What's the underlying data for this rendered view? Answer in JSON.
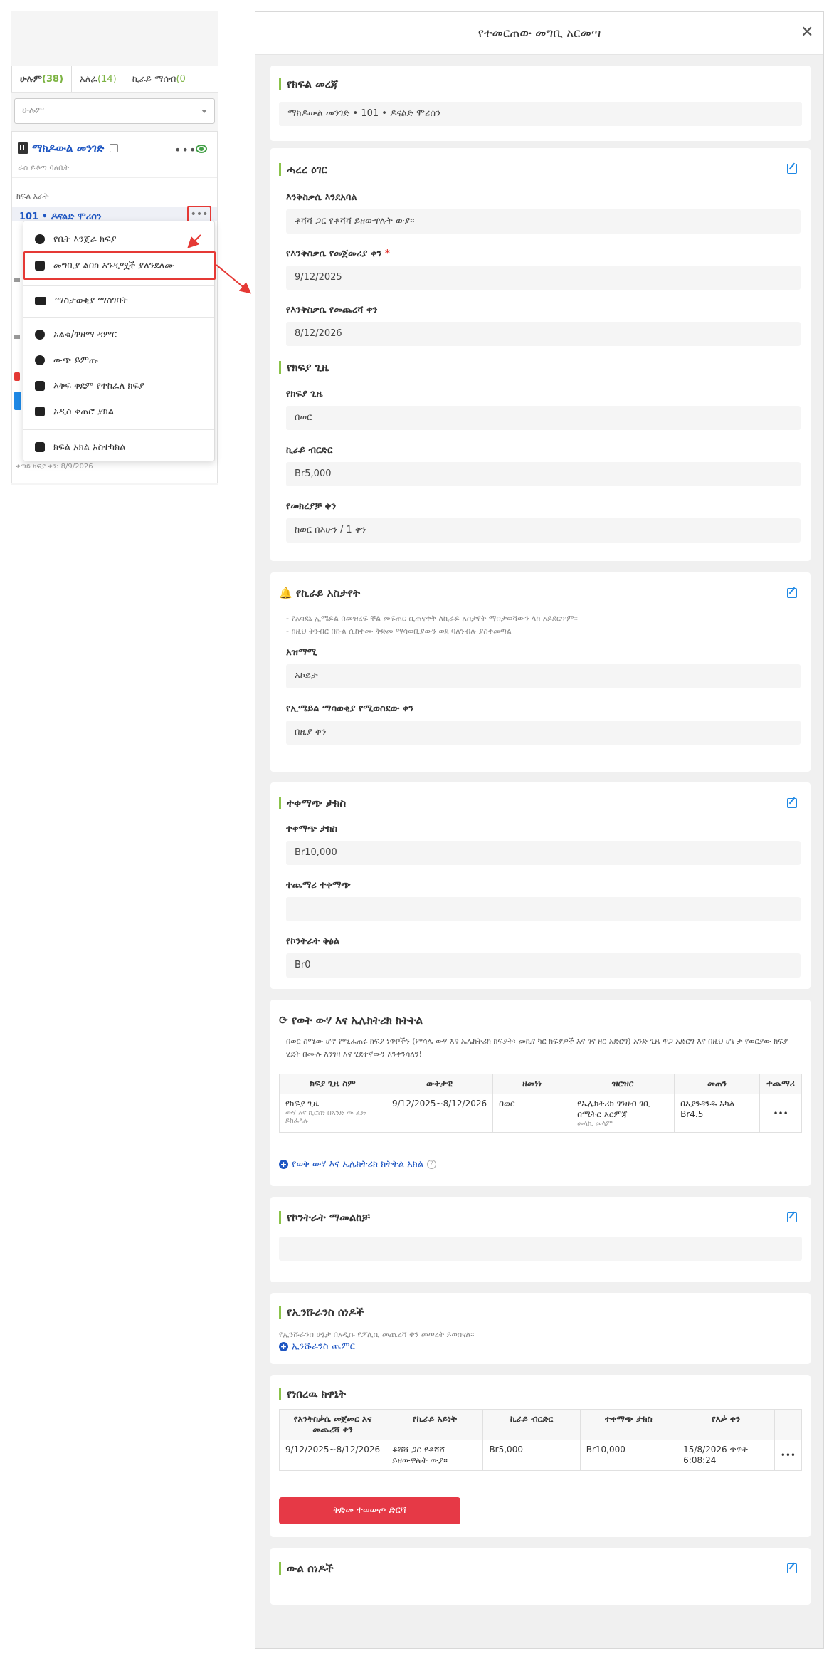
{
  "left": {
    "tabs": [
      {
        "label": "ሁሉም",
        "count": "(38)"
      },
      {
        "label": "አለፈ",
        "count": "(14)"
      },
      {
        "label": "ኪራይ ማሰብ",
        "count": "(0"
      }
    ],
    "filter_value": "ሁሉም",
    "property_name": "ማክዶውል መንገድ",
    "property_sub": "ራስ ይቆጣ ባለቤት",
    "unit_header": "ክፍል አራት",
    "unit_link": "101 • ዶናልድ ሞሪሰን",
    "more": "•••",
    "ghost_date": "ቀጣይ ክፍያ ቀን: 8/9/2026"
  },
  "menu": {
    "items": [
      "የቤት እንጀራ ክፍያ",
      "መግቢያ ልበክ እንዲሟች ያለንደለሙ",
      "ማስታወቂያ ማስገባት",
      "አልቁ/ዋዘማ ዳምር",
      "ውጭ ይምጡ",
      "እቅፍ ቀደም የተከፈለ ክፍያ",
      "አዲስ ቀጠሮ ያክል",
      "ክፍል አክል አስተካክል"
    ]
  },
  "modal": {
    "title": "የተመርጠው መግቢ አርመጣ",
    "close": "✕",
    "unit_info": {
      "title": "የክፍል መረጃ",
      "value": "ማክዶውል መንገድ • 101 • ዶናልድ ሞሪሰን"
    },
    "lease": {
      "title": "ሓረረ ዕገር",
      "desc_label": "እንቅስቃሴ እንደአባል",
      "desc_value": "ቆሻሻ ጋር የቆሻሻ ይዘውዋሉት ውያ።",
      "start_label": "የእንቅስቃሴ የመጀመሪያ ቀን",
      "start_value": "9/12/2025",
      "end_label": "የእንቅስቃሴ የመጨረሻ ቀን",
      "end_value": "8/12/2026",
      "period_title": "የክፍያ ጊዜ",
      "period_label": "የክፍያ ጊዜ",
      "period_value": "በወር",
      "rent_label": "ኪራይ ብርድር",
      "rent_value": "Br5,000",
      "due_label": "የመክረያቻ ቀን",
      "due_value": "ከወር በእሁን / 1 ቀን"
    },
    "reminder": {
      "title": "የኪራይ አስታየት",
      "note1": "- የአሳደኒ ኢሜይል በመዝረፍ ቸል መፍጠር ሲጠናቀቅ ለኪራይ አስታየት ማስታወሻውን ላክ አይደርጥም።",
      "note2": "- ከዚህ ትንብር በኩል ሲከተሙ ቅድመ ማሳወቢያውን ወደ ባለንብሉ ያስቀመጣል",
      "method_label": "አዝማሚ",
      "method_value": "እኮይታ",
      "days_label": "የኢሜይል ማሳወቂያ የሚወስደው ቀን",
      "days_value": "በዚያ ቀን"
    },
    "deposit": {
      "title": "ተቀማጭ ታክስ",
      "dep_label": "ተቀማጭ ታክስ",
      "dep_value": "Br10,000",
      "extra_label": "ተጨማሪ ተቀማጭ",
      "extra_value": "",
      "contract_label": "የኮንትራት ቅፅል",
      "contract_value": "Br0"
    },
    "utilities": {
      "title": "የወት ውሃ እና ኤሌክትሪክ ክትትል",
      "note": "በወር ስሜው ሆኖ የሚፈጠሩ ክፍያ ነጥቦችን (ምሳሌ ውሃ እና ኤሌክትሪክ ክፍያት፣ መኪና ካር ክፍያዎች እና ገና ዘር አድርግ) አንድ ጊዜ ዋጋ አድርግ እና በዚህ ሆኔ ታ የወርያው ክፍያ ሂደት በሙሉ እንገዛ እና ሂደተኛውን እንቀንሳለን!",
      "headers": [
        "ክፍያ ጊዜ ስም",
        "ውትታዊ",
        "ዘመነነ",
        "ዝርዝር",
        "መጠን",
        "ተጨማሪ"
      ],
      "row": {
        "name": "የክፍያ ጊዜ",
        "name_sub": "ውሃ እና ኪሮስነ በአንድ ው ፈድ ይከፈላሉ",
        "dates": "9/12/2025~8/12/2026",
        "freq": "በወር",
        "detail": "የኤሌክትሪክ ገንዘብ ገቢ-በሜትር እርምጃ",
        "detail_sub": "መላኪ መላም",
        "amount": "በእያንዳንዱ አካል Br4.5",
        "more": "•••"
      },
      "add_link": "የወቅ ውሃ እና ኤሌክትሪክ ክትትል አክል",
      "help": "?"
    },
    "contract_notes": {
      "title": "የኮንትራት ማመልከቻ",
      "value": ""
    },
    "insurance": {
      "title": "የኢንሹራንስ ሰነዶች",
      "note": "የኢንሹራንስ ሁኔታ በአዲሱ የፖሊሲ መጨረሻ ቀን መሠረት ይወሰናል።",
      "add_link": "ኢንሹራንስ ጨምር"
    },
    "history": {
      "title": "የነበረዉ ክዋኔት",
      "headers": [
        "የእንቅስቃሴ መጀመር እና መጨረሻ ቀን",
        "የኪራይ አይነት",
        "ኪራይ ብርድር",
        "ተቀማጭ ታክስ",
        "የእቃ ቀን",
        ""
      ],
      "row": {
        "dates": "9/12/2025~8/12/2026",
        "type": "ቆሻሻ ጋር የቆሻሻ ይዘውዋሉት ውያ።",
        "rent": "Br5,000",
        "deposit": "Br10,000",
        "date": "15/8/2026 ጥዋት 6:08:24",
        "more": "•••"
      },
      "terminate_label": "ቅድመ ተወውጦ ድርሻ"
    },
    "documents": {
      "title": "ውል ሰነዶች"
    }
  }
}
